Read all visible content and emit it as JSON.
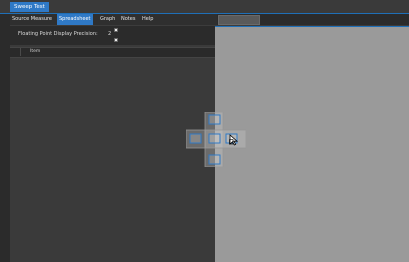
{
  "window": {
    "tab_title": "Sweep Test"
  },
  "menu": {
    "items": [
      "Source Measure",
      "Spreadsheet",
      "Graph",
      "Notes",
      "Help"
    ],
    "active": "Spreadsheet"
  },
  "precision": {
    "label": "Floating Point Display Precision:",
    "value": "2"
  },
  "table": {
    "column_header": "Item"
  },
  "icons": {
    "spin_up": "chevron-up-icon",
    "spin_down": "chevron-down-icon",
    "dock": "docking-guide-icon",
    "cursor": "mouse-pointer-icon"
  },
  "colors": {
    "accent": "#2f79c6",
    "dark_bg": "#3a3a3a",
    "preview_bg": "#9a9a9a"
  }
}
